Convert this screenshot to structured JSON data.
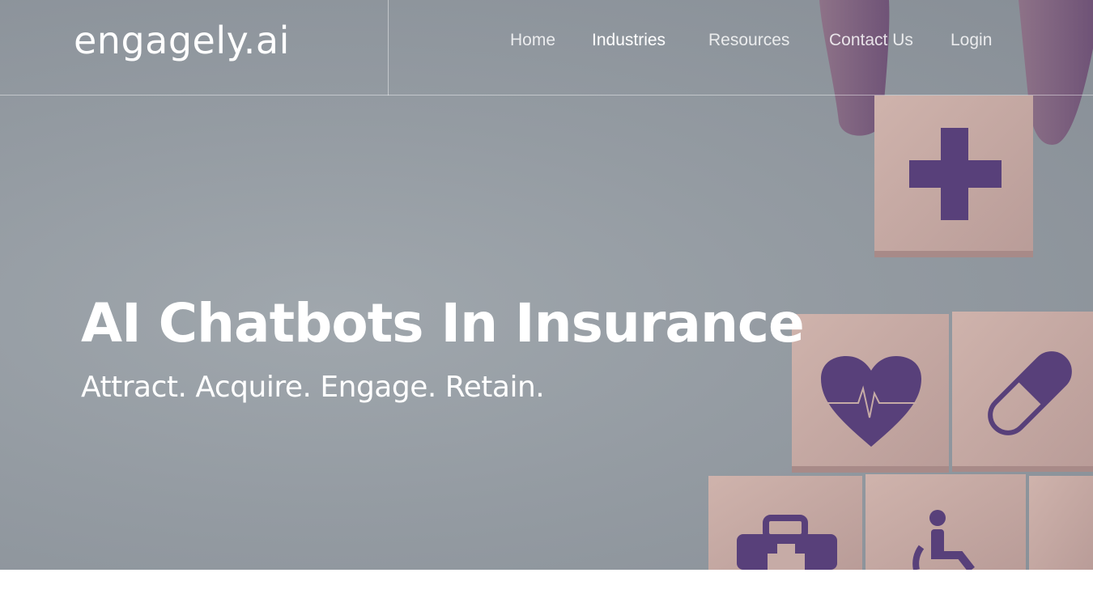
{
  "brand": {
    "logo_text": "engagely.ai"
  },
  "nav": {
    "items": [
      {
        "label": "Home"
      },
      {
        "label": "Industries"
      },
      {
        "label": "Resources"
      },
      {
        "label": "Contact Us"
      },
      {
        "label": "Login"
      }
    ]
  },
  "hero": {
    "title": "AI Chatbots In Insurance",
    "subtitle": "Attract. Acquire. Engage. Retain.",
    "icons": [
      "plus-icon",
      "heart-pulse-icon",
      "pill-icon",
      "first-aid-kit-icon",
      "wheelchair-icon"
    ]
  },
  "colors": {
    "icon_purple": "#58407a",
    "block_wood": "#c6aba6",
    "background_gray": "#949ba2",
    "text_white": "#ffffff"
  }
}
